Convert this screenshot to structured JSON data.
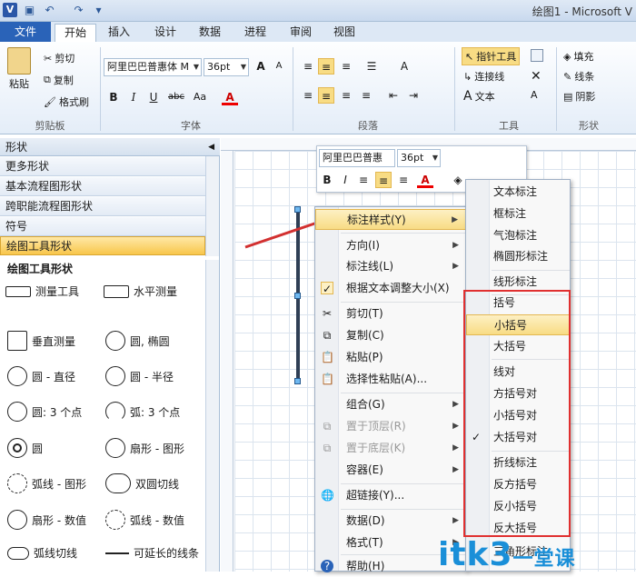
{
  "window": {
    "title": "绘图1 - Microsoft V"
  },
  "ribbon_tabs": [
    "文件",
    "开始",
    "插入",
    "设计",
    "数据",
    "进程",
    "审阅",
    "视图"
  ],
  "clipboard": {
    "paste": "粘贴",
    "cut": "剪切",
    "copy": "复制",
    "format_painter": "格式刷",
    "label": "剪贴板"
  },
  "font": {
    "family": "阿里巴巴普惠体 M",
    "size": "36pt",
    "label": "字体",
    "bold": "B",
    "italic": "I",
    "underline": "U",
    "strike": "abc",
    "case": "Aa",
    "color": "A",
    "grow": "A",
    "shrink": "A"
  },
  "paragraph": {
    "label": "段落"
  },
  "tools": {
    "pointer": "指针工具",
    "connector": "连接线",
    "text": "文本",
    "label": "工具"
  },
  "shape_group": {
    "fill": "填充",
    "line": "线条",
    "shadow": "阴影",
    "label": "形状"
  },
  "shapes_panel": {
    "title": "形状",
    "stencils": [
      "更多形状",
      "基本流程图形状",
      "跨职能流程图形状",
      "符号",
      "绘图工具形状"
    ],
    "section_title": "绘图工具形状",
    "items": [
      "测量工具",
      "水平测量",
      "垂直测量",
      "圆, 椭圆",
      "圆 - 直径",
      "圆 - 半径",
      "圆: 3 个点",
      "弧: 3 个点",
      "圆",
      "扇形 - 图形",
      "弧线 - 图形",
      "双圆切线",
      "扇形 - 数值",
      "弧线 - 数值",
      "弧线切线",
      "可延长的线条"
    ]
  },
  "mini_toolbar": {
    "font": "阿里巴巴普惠",
    "size": "36pt"
  },
  "context_menu": {
    "items": [
      "标注样式(Y)",
      "方向(I)",
      "标注线(L)",
      "根据文本调整大小(X)",
      "剪切(T)",
      "复制(C)",
      "粘贴(P)",
      "选择性粘贴(A)...",
      "组合(G)",
      "置于顶层(R)",
      "置于底层(K)",
      "容器(E)",
      "超链接(Y)...",
      "数据(D)",
      "格式(T)",
      "帮助(H)"
    ]
  },
  "submenu": {
    "items": [
      "文本标注",
      "框标注",
      "气泡标注",
      "椭圆形标注",
      "线形标注",
      "括号",
      "小括号",
      "大括号",
      "线对",
      "方括号对",
      "小括号对",
      "大括号对",
      "折线标注",
      "反方括号",
      "反小括号",
      "反大括号",
      "三角形标注"
    ]
  },
  "watermark": {
    "text": "itk3",
    "sub": "一堂课"
  },
  "colors": {
    "highlight": "#f8dc84",
    "file_tab": "#2a63b8",
    "red_box": "#e03030",
    "arrow": "#d23030"
  }
}
